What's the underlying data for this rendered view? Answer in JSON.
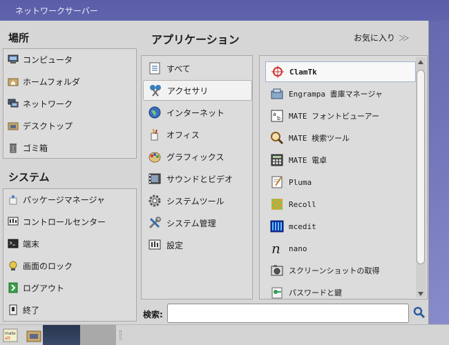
{
  "window": {
    "title": "ネットワークサーバー"
  },
  "places": {
    "title": "場所",
    "items": [
      {
        "label": "コンピュータ",
        "icon": "computer-icon"
      },
      {
        "label": "ホームフォルダ",
        "icon": "home-folder-icon"
      },
      {
        "label": "ネットワーク",
        "icon": "network-icon"
      },
      {
        "label": "デスクトップ",
        "icon": "desktop-folder-icon"
      },
      {
        "label": "ゴミ箱",
        "icon": "trash-icon"
      }
    ]
  },
  "system": {
    "title": "システム",
    "items": [
      {
        "label": "パッケージマネージャ",
        "icon": "package-icon"
      },
      {
        "label": "コントロールセンター",
        "icon": "control-center-icon"
      },
      {
        "label": "端末",
        "icon": "terminal-icon"
      },
      {
        "label": "画面のロック",
        "icon": "lock-screen-icon"
      },
      {
        "label": "ログアウト",
        "icon": "logout-icon"
      },
      {
        "label": "終了",
        "icon": "shutdown-icon"
      }
    ]
  },
  "applications": {
    "title": "アプリケーション",
    "favorites_label": "お気に入り",
    "categories": [
      {
        "label": "すべて",
        "icon": "all-icon"
      },
      {
        "label": "アクセサリ",
        "icon": "accessories-icon"
      },
      {
        "label": "インターネット",
        "icon": "internet-icon"
      },
      {
        "label": "オフィス",
        "icon": "office-icon"
      },
      {
        "label": "グラフィックス",
        "icon": "graphics-icon"
      },
      {
        "label": "サウンドとビデオ",
        "icon": "sound-video-icon"
      },
      {
        "label": "システムツール",
        "icon": "system-tools-icon"
      },
      {
        "label": "システム管理",
        "icon": "system-admin-icon"
      },
      {
        "label": "設定",
        "icon": "settings-icon"
      }
    ],
    "active_category": 1,
    "apps": [
      {
        "label": "ClamTk",
        "icon": "clamtk-icon",
        "mono": true,
        "bold": true
      },
      {
        "label": "Engrampa 書庫マネージャ",
        "icon": "engrampa-icon",
        "mono": true
      },
      {
        "label": "MATE フォントビューアー",
        "icon": "font-viewer-icon",
        "mono": true
      },
      {
        "label": "MATE 検索ツール",
        "icon": "search-tool-icon",
        "mono": true
      },
      {
        "label": "MATE 電卓",
        "icon": "calculator-icon",
        "mono": true
      },
      {
        "label": "Pluma",
        "icon": "pluma-icon",
        "mono": true
      },
      {
        "label": "Recoll",
        "icon": "recoll-icon",
        "mono": true
      },
      {
        "label": "mcedit",
        "icon": "mcedit-icon",
        "mono": true
      },
      {
        "label": "nano",
        "icon": "nano-icon",
        "mono": true
      },
      {
        "label": "スクリーンショットの取得",
        "icon": "screenshot-icon",
        "mono": false
      },
      {
        "label": "パスワードと鍵",
        "icon": "passwords-keys-icon",
        "mono": false
      }
    ]
  },
  "search": {
    "label": "検索:",
    "value": "",
    "placeholder": ""
  },
  "colors": {
    "accent": "#5b5fa6",
    "panel": "#d6d6d6"
  }
}
